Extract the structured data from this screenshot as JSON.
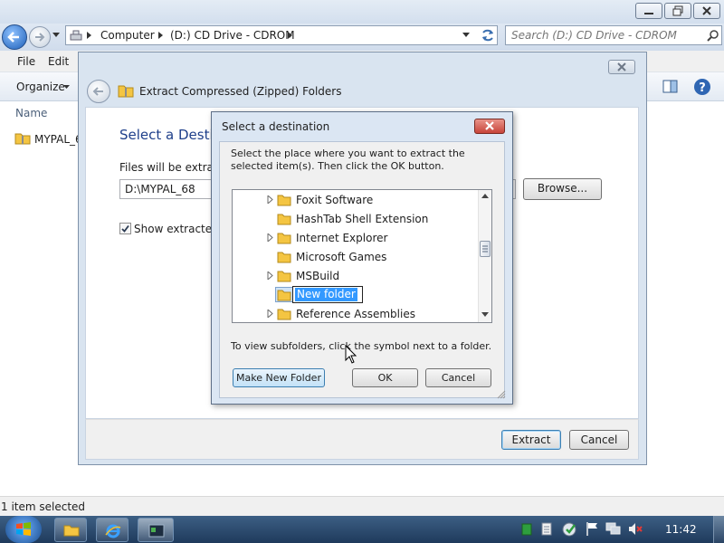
{
  "explorer": {
    "address": {
      "crumbs": [
        "Computer",
        "(D:) CD Drive - CDROM"
      ]
    },
    "search": {
      "placeholder": "Search (D:) CD Drive - CDROM"
    },
    "menu": {
      "file": "File",
      "edit": "Edit"
    },
    "toolbar": {
      "organize": "Organize"
    },
    "columns": {
      "name": "Name"
    },
    "file_item": "MYPAL_6",
    "status": "1 item selected"
  },
  "wizard": {
    "title": "Extract Compressed (Zipped) Folders",
    "heading": "Select a Destin",
    "files_label": "Files will be extracte",
    "path_value": "D:\\MYPAL_68",
    "browse_label": "Browse...",
    "show_label": "Show extracted f",
    "show_checked": true,
    "extract_label": "Extract",
    "cancel_label": "Cancel"
  },
  "dialog": {
    "title": "Select a destination",
    "instruction": "Select the place where you want to extract the selected item(s).  Then click the OK button.",
    "tree": [
      {
        "label": "Foxit Software",
        "expandable": true
      },
      {
        "label": "HashTab Shell Extension",
        "expandable": false
      },
      {
        "label": "Internet Explorer",
        "expandable": true
      },
      {
        "label": "Microsoft Games",
        "expandable": false
      },
      {
        "label": "MSBuild",
        "expandable": true
      },
      {
        "label": "New folder",
        "expandable": false,
        "editing": true
      },
      {
        "label": "Reference Assemblies",
        "expandable": true
      }
    ],
    "hint": "To view subfolders, click the symbol next to a folder.",
    "make_new_folder_label": "Make New Folder",
    "ok_label": "OK",
    "cancel_label": "Cancel"
  },
  "taskbar": {
    "clock": "11:42"
  },
  "colors": {
    "accent": "#3399ff",
    "close_red": "#c7443a",
    "folder": "#f4c542"
  }
}
